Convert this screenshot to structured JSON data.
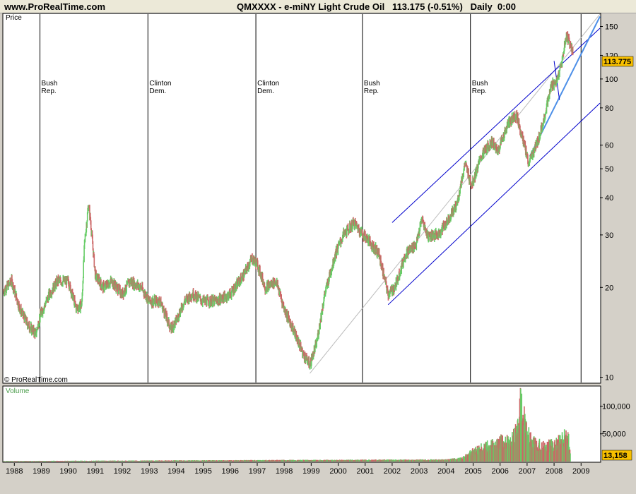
{
  "header": {
    "site": "www.ProRealTime.com",
    "title": "QMXXXX - e-miNY Light Crude Oil   113.175 (-0.51%)   Daily  0:00"
  },
  "price_panel": {
    "label": "Price",
    "watermark": "© ProRealTime.com",
    "last_value": "113.775"
  },
  "volume_panel": {
    "label": "Volume",
    "last_value": "13,158"
  },
  "colors": {
    "up": "#66cc66",
    "down": "#cc6666",
    "trend": "#0000cc",
    "trend_light": "#4d8fe8",
    "last_tag": "#f8c000"
  },
  "chart_data": [
    {
      "type": "candlestick",
      "title": "QMXXXX - e-miNY Light Crude Oil",
      "y_scale": "log",
      "ylim": [
        9.6,
        165
      ],
      "xlim": [
        1987.6,
        2009.7
      ],
      "y_ticks": [
        10,
        20,
        30,
        40,
        50,
        60,
        80,
        100,
        120,
        150
      ],
      "x_ticks": [
        "1988",
        "1989",
        "1990",
        "1991",
        "1992",
        "1993",
        "1994",
        "1995",
        "1996",
        "1997",
        "1998",
        "1999",
        "2000",
        "2001",
        "2002",
        "2003",
        "2004",
        "2005",
        "2006",
        "2007",
        "2008",
        "2009"
      ],
      "series": [
        {
          "x": [
            1987.6,
            1987.9,
            1988.2,
            1988.5,
            1988.8,
            1988.95,
            1989.3,
            1989.6,
            1990.0,
            1990.3,
            1990.5,
            1990.6,
            1990.75,
            1990.83,
            1991.0,
            1991.3,
            1991.6,
            1992.0,
            1992.3,
            1992.7,
            1993.0,
            1993.4,
            1993.8,
            1994.0,
            1994.3,
            1994.6,
            1995.0,
            1995.5,
            1996.0,
            1996.5,
            1996.8,
            1997.0,
            1997.3,
            1997.7,
            1998.0,
            1998.4,
            1998.7,
            1998.95,
            1999.2,
            1999.5,
            1999.9,
            2000.2,
            2000.6,
            2000.8,
            2001.1,
            2001.5,
            2001.85,
            2002.1,
            2002.5,
            2002.9,
            2003.1,
            2003.3,
            2003.7,
            2004.0,
            2004.4,
            2004.7,
            2004.95,
            2005.3,
            2005.7,
            2005.9,
            2006.3,
            2006.6,
            2006.9,
            2007.05,
            2007.4,
            2007.6,
            2007.9,
            2008.1,
            2008.3,
            2008.45,
            2008.55,
            2008.7
          ],
          "close": [
            19.5,
            21,
            17,
            15,
            14,
            16,
            19,
            21,
            21,
            17,
            17.5,
            28,
            38,
            33,
            22,
            20,
            21,
            19,
            21,
            20,
            18,
            18,
            14.5,
            15.5,
            18,
            19,
            18,
            18,
            19,
            22,
            25,
            24,
            20,
            21,
            17,
            14,
            12,
            11,
            13,
            19,
            26,
            30,
            33,
            31,
            29,
            26,
            19,
            20,
            26,
            28,
            34,
            30,
            30,
            33,
            38,
            52,
            44,
            55,
            62,
            57,
            71,
            76,
            60,
            52,
            62,
            72,
            95,
            98,
            115,
            140,
            135,
            123
          ]
        }
      ],
      "annotations": [
        {
          "x": 1988.95,
          "text": "Bush\nRep."
        },
        {
          "x": 1992.95,
          "text": "Clinton\nDem."
        },
        {
          "x": 1996.95,
          "text": "Clinton\nDem."
        },
        {
          "x": 2000.9,
          "text": "Bush\nRep."
        },
        {
          "x": 2004.9,
          "text": "Bush\nRep."
        },
        {
          "x": 2009.0,
          "text": ""
        }
      ],
      "trendlines": [
        {
          "x1": 1998.95,
          "y1": 10.3,
          "x2": 2009.7,
          "y2": 165,
          "style": "light"
        },
        {
          "x1": 2001.85,
          "y1": 17.5,
          "x2": 2009.7,
          "y2": 83,
          "style": "dark"
        },
        {
          "x1": 2002.0,
          "y1": 33,
          "x2": 2009.7,
          "y2": 148,
          "style": "dark"
        },
        {
          "x1": 2007.1,
          "y1": 55,
          "x2": 2009.7,
          "y2": 162,
          "style": "bright"
        },
        {
          "x1": 2008.0,
          "y1": 115,
          "x2": 2008.2,
          "y2": 85,
          "style": "dark"
        }
      ]
    },
    {
      "type": "bar",
      "title": "Volume",
      "ylim": [
        0,
        135000
      ],
      "y_ticks": [
        50000,
        100000
      ],
      "y_tick_labels": [
        "50,000",
        "100,000"
      ],
      "series": [
        {
          "x": [
            1987.6,
            2004.0,
            2004.6,
            2005.0,
            2005.4,
            2005.8,
            2006.0,
            2006.3,
            2006.5,
            2006.7,
            2006.75,
            2006.8,
            2006.9,
            2007.1,
            2007.4,
            2007.7,
            2008.0,
            2008.3,
            2008.5,
            2008.6
          ],
          "values": [
            800,
            3000,
            6000,
            18000,
            26000,
            30000,
            35000,
            38000,
            42000,
            60000,
            120000,
            110000,
            70000,
            40000,
            30000,
            28000,
            30000,
            38000,
            50000,
            14000
          ]
        }
      ]
    }
  ]
}
